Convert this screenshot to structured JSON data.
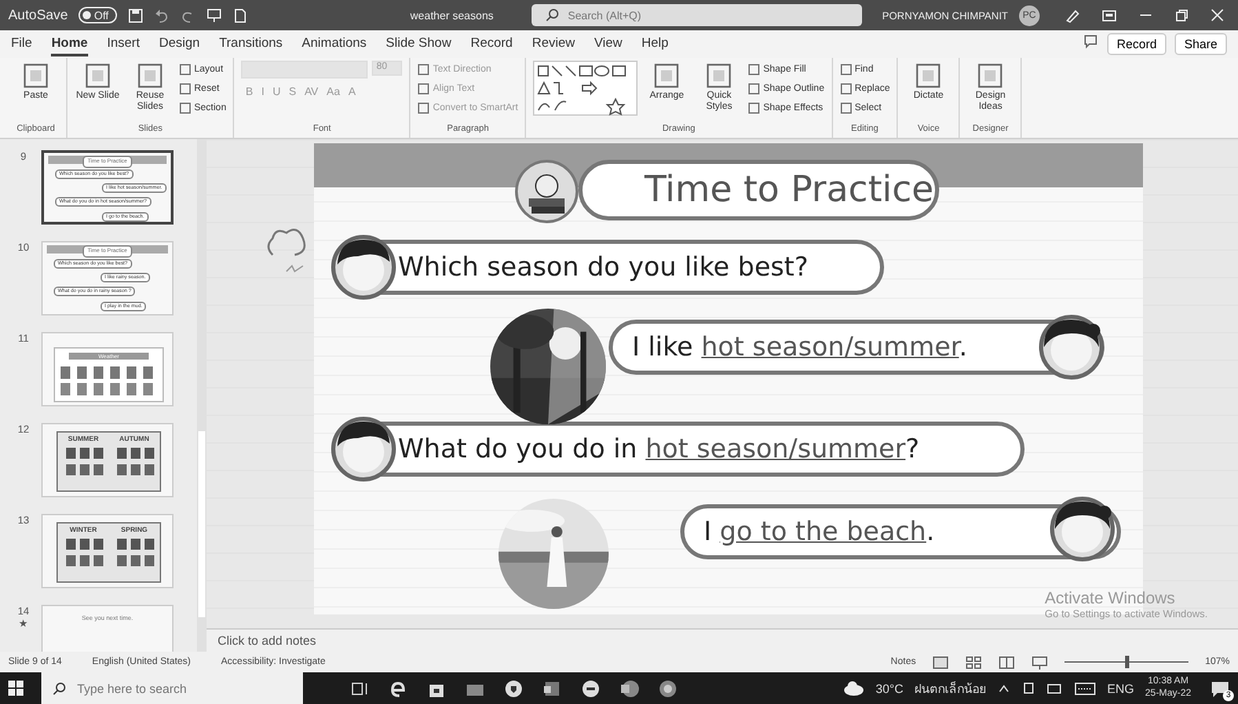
{
  "title_bar": {
    "autosave_label": "AutoSave",
    "autosave_toggle": {
      "label": "Off",
      "on": false
    },
    "file_name": "weather seasons",
    "search_placeholder": "Search (Alt+Q)",
    "user_name": "PORNYAMON CHIMPANIT",
    "user_initials": "PC"
  },
  "menu_tabs": [
    {
      "label": "File",
      "selected": false
    },
    {
      "label": "Home",
      "selected": true
    },
    {
      "label": "Insert",
      "selected": false
    },
    {
      "label": "Design",
      "selected": false
    },
    {
      "label": "Transitions",
      "selected": false
    },
    {
      "label": "Animations",
      "selected": false
    },
    {
      "label": "Slide Show",
      "selected": false
    },
    {
      "label": "Record",
      "selected": false
    },
    {
      "label": "Review",
      "selected": false
    },
    {
      "label": "View",
      "selected": false
    },
    {
      "label": "Help",
      "selected": false
    }
  ],
  "top_buttons": [
    "Record",
    "Share"
  ],
  "ribbon_groups": [
    {
      "label": "Clipboard",
      "disabled": false,
      "items": [
        {
          "kind": "large",
          "label": "Paste"
        }
      ]
    },
    {
      "label": "Slides",
      "disabled": false,
      "items": [
        {
          "kind": "large",
          "label": "New Slide"
        },
        {
          "kind": "large",
          "label": "Reuse Slides"
        },
        {
          "kind": "small",
          "label": "Layout"
        },
        {
          "kind": "small",
          "label": "Reset"
        },
        {
          "kind": "small",
          "label": "Section"
        }
      ]
    },
    {
      "label": "Font",
      "disabled": true,
      "items": [
        {
          "kind": "field"
        },
        {
          "kind": "size",
          "label": "80"
        },
        {
          "kind": "glyph",
          "label": "B"
        },
        {
          "kind": "glyph",
          "label": "I"
        },
        {
          "kind": "glyph",
          "label": "U"
        },
        {
          "kind": "glyph",
          "label": "S"
        },
        {
          "kind": "glyph",
          "label": "AV"
        },
        {
          "kind": "glyph",
          "label": "Aa"
        },
        {
          "kind": "glyph",
          "label": "A"
        }
      ]
    },
    {
      "label": "Paragraph",
      "disabled": true,
      "items": [
        {
          "kind": "small",
          "label": "Text Direction"
        },
        {
          "kind": "small",
          "label": "Align Text"
        },
        {
          "kind": "small",
          "label": "Convert to SmartArt"
        }
      ]
    },
    {
      "label": "Drawing",
      "disabled": false,
      "items": [
        {
          "kind": "shapes"
        },
        {
          "kind": "large",
          "label": "Arrange"
        },
        {
          "kind": "large",
          "label": "Quick Styles"
        },
        {
          "kind": "small",
          "label": "Shape Fill"
        },
        {
          "kind": "small",
          "label": "Shape Outline"
        },
        {
          "kind": "small",
          "label": "Shape Effects"
        }
      ]
    },
    {
      "label": "Editing",
      "disabled": false,
      "items": [
        {
          "kind": "small",
          "label": "Find"
        },
        {
          "kind": "small",
          "label": "Replace"
        },
        {
          "kind": "small",
          "label": "Select"
        }
      ]
    },
    {
      "label": "Voice",
      "disabled": false,
      "items": [
        {
          "kind": "large",
          "label": "Dictate"
        }
      ]
    },
    {
      "label": "Designer",
      "disabled": false,
      "items": [
        {
          "kind": "large",
          "label": "Design Ideas"
        }
      ]
    }
  ],
  "thumbnails": [
    {
      "number": "9",
      "selected": true,
      "kind": "practice",
      "title": "Time to Practice",
      "lines": [
        "Which season do you like best?",
        "I like hot season/summer.",
        "What do you do in hot season/summer?",
        "I go to the beach."
      ]
    },
    {
      "number": "10",
      "selected": false,
      "kind": "practice",
      "title": "Time to Practice",
      "lines": [
        "Which season do you like best?",
        "I like rainy season.",
        "What do you do in rainy season ?",
        "I play in the mud."
      ]
    },
    {
      "number": "11",
      "selected": false,
      "kind": "grid",
      "title": "Weather"
    },
    {
      "number": "12",
      "selected": false,
      "kind": "season",
      "titles": [
        "SUMMER",
        "AUTUMN"
      ]
    },
    {
      "number": "13",
      "selected": false,
      "kind": "season",
      "titles": [
        "WINTER",
        "SPRING"
      ]
    },
    {
      "number": "14",
      "selected": false,
      "kind": "end",
      "title": "See you next time.",
      "marker": "★"
    }
  ],
  "slide": {
    "title": "Time to Practice",
    "bubbles": [
      {
        "kind": "boy",
        "before": "Which season do you like best?"
      },
      {
        "kind": "girl",
        "before": "I like ",
        "blank": "hot season/summer",
        "after": "."
      },
      {
        "kind": "boy",
        "before": "What do you do in ",
        "blank": "hot season/summer",
        "after": "?"
      },
      {
        "kind": "girl",
        "before": "I ",
        "blank": "go to the beach",
        "after": "."
      }
    ]
  },
  "notes_placeholder": "Click to add notes",
  "activation": {
    "title": "Activate Windows",
    "hint": "Go to Settings to activate Windows."
  },
  "status_bar": {
    "slide": "Slide 9 of 14",
    "language": "English (United States)",
    "accessibility": "Accessibility: Investigate",
    "notes": "Notes",
    "zoom": {
      "level": 0.5
    },
    "zoom_text": "107%"
  },
  "taskbar": {
    "search_placeholder": "Type here to search",
    "temperature": "30°C",
    "weather": "ฝนตกเล็กน้อย",
    "language": "ENG",
    "time": "10:38 AM",
    "date": "25-May-22",
    "notifications": "3"
  }
}
